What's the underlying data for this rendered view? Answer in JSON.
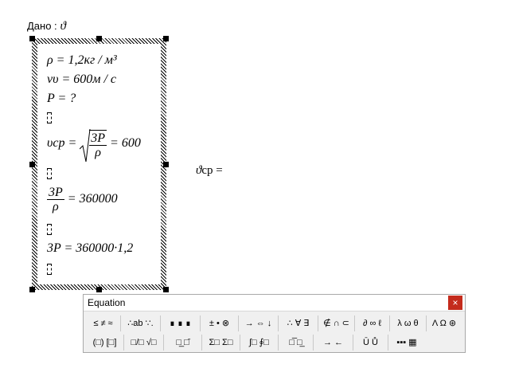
{
  "given": {
    "label": "Дано :",
    "symbol": "ϑ"
  },
  "equations": {
    "line1": "ρ = 1,2кг / м³",
    "line2": "νυ = 600м / с",
    "line3": "P = ?",
    "line4_lhs": "υср =",
    "line4_num": "3P",
    "line4_den": "ρ",
    "line4_rhs": "= 600",
    "line5_num": "3P",
    "line5_den": "ρ",
    "line5_rhs": "= 360000",
    "line6": "3P = 360000·1,2"
  },
  "speed_label": {
    "symbol": "ϑ",
    "text": "ср ="
  },
  "equation_toolbar": {
    "title": "Equation",
    "close": "×",
    "row1": [
      "≤ ≠ ≈",
      "∴ab ∵.",
      "∎ ∎ ∎",
      "± • ⊗",
      "→ ⇔ ↓",
      "∴ ∀ ∃",
      "∉ ∩ ⊂",
      "∂ ∞ ℓ",
      "λ ω θ",
      "Λ Ω ⊛"
    ],
    "row2": [
      "(□) [□]",
      "□/□ √□",
      "□̲ □̄",
      "Σ□ Σ□",
      "∫□ ∮□",
      "□̅ □̲",
      "→ ←",
      "Ū Ů",
      "▪▪▪ ▦"
    ]
  }
}
